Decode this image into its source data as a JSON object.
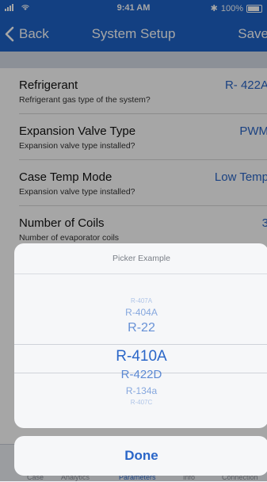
{
  "status_bar": {
    "time": "9:41 AM",
    "signal": "ıl",
    "wifi": "wifi",
    "bluetooth": "✱",
    "battery_percent": "100%",
    "battery_level": 1.0
  },
  "nav": {
    "back_label": "Back",
    "title": "System Setup",
    "save_label": "Save"
  },
  "settings": [
    {
      "title": "Refrigerant",
      "subtitle": "Refrigerant gas type of the system?",
      "value": "R- 422A"
    },
    {
      "title": "Expansion Valve Type",
      "subtitle": "Expansion valve type installed?",
      "value": "PWM"
    },
    {
      "title": "Case Temp Mode",
      "subtitle": "Expansion valve type installed?",
      "value": "Low Temp"
    },
    {
      "title": "Number of Coils",
      "subtitle": "Number of evaporator coils",
      "value": "3"
    }
  ],
  "tabbar": {
    "items": [
      "Case",
      "Analytics",
      "Parameters",
      "Info",
      "Connection"
    ]
  },
  "picker": {
    "title": "Picker Example",
    "options": [
      "R-407A",
      "R-404A",
      "R-22",
      "R-410A",
      "R-422D",
      "R-134a",
      "R-407C"
    ],
    "selected": "R-410A"
  },
  "done_label": "Done",
  "colors": {
    "accent": "#1e63c8",
    "link": "#2a66c8",
    "sheet": "#f6f7f9"
  }
}
